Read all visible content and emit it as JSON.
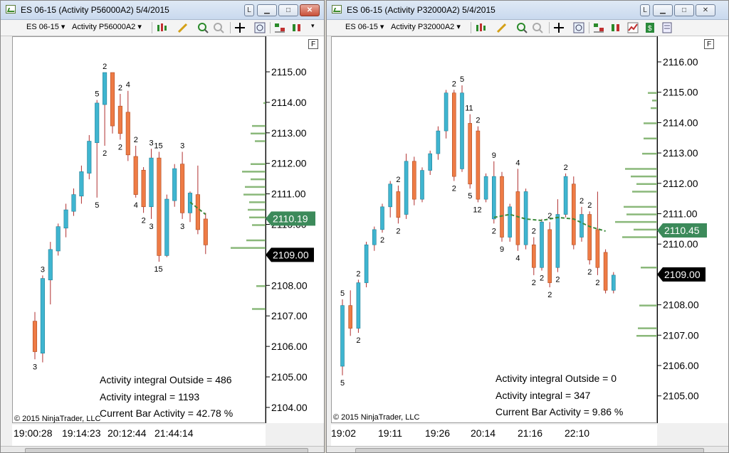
{
  "left": {
    "title": "ES 06-15 (Activity P56000A2)  5/4/2015",
    "instrument": "ES 06-15",
    "period": "Activity P56000A2",
    "f_label": "F",
    "price_min": 2104.0,
    "price_max": 2115.0,
    "y_ticks": [
      "2115.00",
      "2114.00",
      "2113.00",
      "2112.00",
      "2111.00",
      "2110.00",
      "2109.00",
      "2108.00",
      "2107.00",
      "2106.00",
      "2105.00",
      "2104.00"
    ],
    "x_labels": [
      "19:00:28",
      "19:14:23",
      "20:12:44",
      "21:44:14"
    ],
    "last_price": "2110.19",
    "current_price": "2109.00",
    "stat_outside": "Activity integral Outside  = 486",
    "stat_integral": "Activity integral = 1193",
    "stat_current": "Current Bar Activity = 42.78 %",
    "copyright": "© 2015 NinjaTrader, LLC",
    "candles": [
      {
        "o": 2106.85,
        "c": 2105.85,
        "h": 2107.15,
        "l": 2105.6,
        "up": false
      },
      {
        "o": 2105.8,
        "c": 2108.25,
        "h": 2108.35,
        "l": 2105.5,
        "up": true
      },
      {
        "o": 2108.2,
        "c": 2109.2,
        "h": 2109.45,
        "l": 2107.4,
        "up": true
      },
      {
        "o": 2109.15,
        "c": 2109.95,
        "h": 2110.05,
        "l": 2109.0,
        "up": true
      },
      {
        "o": 2109.9,
        "c": 2110.5,
        "h": 2110.7,
        "l": 2109.6,
        "up": true
      },
      {
        "o": 2110.45,
        "c": 2111.0,
        "h": 2111.2,
        "l": 2110.3,
        "up": true
      },
      {
        "o": 2110.95,
        "c": 2111.75,
        "h": 2111.95,
        "l": 2110.7,
        "up": true
      },
      {
        "o": 2111.7,
        "c": 2112.75,
        "h": 2112.95,
        "l": 2111.5,
        "up": true
      },
      {
        "o": 2112.7,
        "c": 2114.0,
        "h": 2114.1,
        "l": 2110.9,
        "up": true
      },
      {
        "o": 2113.95,
        "c": 2115.0,
        "h": 2115.0,
        "l": 2112.6,
        "up": true
      },
      {
        "o": 2115.0,
        "c": 2113.25,
        "h": 2115.0,
        "l": 2113.0,
        "up": false
      },
      {
        "o": 2113.9,
        "c": 2113.0,
        "h": 2114.3,
        "l": 2112.8,
        "up": false
      },
      {
        "o": 2113.7,
        "c": 2112.3,
        "h": 2114.4,
        "l": 2112.1,
        "up": false
      },
      {
        "o": 2112.25,
        "c": 2111.0,
        "h": 2112.6,
        "l": 2110.9,
        "up": false
      },
      {
        "o": 2111.8,
        "c": 2110.6,
        "h": 2111.9,
        "l": 2110.4,
        "up": false
      },
      {
        "o": 2110.6,
        "c": 2112.2,
        "h": 2112.5,
        "l": 2110.2,
        "up": true
      },
      {
        "o": 2112.2,
        "c": 2109.0,
        "h": 2112.4,
        "l": 2108.8,
        "up": false
      },
      {
        "o": 2109.0,
        "c": 2110.85,
        "h": 2111.0,
        "l": 2108.95,
        "up": true
      },
      {
        "o": 2110.8,
        "c": 2111.85,
        "h": 2112.0,
        "l": 2110.6,
        "up": true
      },
      {
        "o": 2112.0,
        "c": 2110.4,
        "h": 2112.4,
        "l": 2110.2,
        "up": false
      },
      {
        "o": 2110.4,
        "c": 2111.05,
        "h": 2111.1,
        "l": 2110.1,
        "up": true
      },
      {
        "o": 2111.0,
        "c": 2109.85,
        "h": 2111.95,
        "l": 2109.7,
        "up": false
      },
      {
        "o": 2110.2,
        "c": 2109.35,
        "h": 2110.4,
        "l": 2109.05,
        "up": false
      }
    ],
    "labels": [
      {
        "i": 0,
        "pos": "below",
        "t": "3"
      },
      {
        "i": 1,
        "pos": "above",
        "t": "3"
      },
      {
        "i": 8,
        "pos": "above",
        "t": "5"
      },
      {
        "i": 8,
        "pos": "below",
        "t": "5"
      },
      {
        "i": 9,
        "pos": "above",
        "t": "2"
      },
      {
        "i": 9,
        "pos": "below",
        "t": "2"
      },
      {
        "i": 11,
        "pos": "above",
        "t": "2"
      },
      {
        "i": 12,
        "pos": "above",
        "t": "4"
      },
      {
        "i": 11,
        "pos": "below",
        "t": "2"
      },
      {
        "i": 13,
        "pos": "above",
        "t": "2"
      },
      {
        "i": 13,
        "pos": "below",
        "t": "4"
      },
      {
        "i": 14,
        "pos": "below",
        "t": "2"
      },
      {
        "i": 15,
        "pos": "above",
        "t": "3"
      },
      {
        "i": 15,
        "pos": "below",
        "t": "3"
      },
      {
        "i": 16,
        "pos": "above",
        "t": "15"
      },
      {
        "i": 16,
        "pos": "below",
        "t": "15"
      },
      {
        "i": 19,
        "pos": "above",
        "t": "3"
      },
      {
        "i": 19,
        "pos": "below",
        "t": "3"
      }
    ],
    "ma": [
      [
        20,
        2110.75
      ],
      [
        21,
        2110.55
      ],
      [
        22,
        2110.35
      ]
    ],
    "volume_profile": [
      {
        "p": 2114.0,
        "w": 4
      },
      {
        "p": 2113.25,
        "w": 20
      },
      {
        "p": 2113.0,
        "w": 22
      },
      {
        "p": 2112.75,
        "w": 16
      },
      {
        "p": 2112.0,
        "w": 22
      },
      {
        "p": 2111.75,
        "w": 34
      },
      {
        "p": 2111.5,
        "w": 22
      },
      {
        "p": 2111.25,
        "w": 30
      },
      {
        "p": 2111.0,
        "w": 32
      },
      {
        "p": 2110.75,
        "w": 24
      },
      {
        "p": 2110.5,
        "w": 26
      },
      {
        "p": 2110.25,
        "w": 24
      },
      {
        "p": 2110.0,
        "w": 20
      },
      {
        "p": 2109.5,
        "w": 28
      },
      {
        "p": 2109.25,
        "w": 50
      },
      {
        "p": 2108.0,
        "w": 14
      },
      {
        "p": 2107.25,
        "w": 20
      }
    ]
  },
  "right": {
    "title": "ES 06-15 (Activity P32000A2)  5/4/2015",
    "instrument": "ES 06-15",
    "period": "Activity P32000A2",
    "f_label": "F",
    "price_min": 2105.0,
    "price_max": 2116.0,
    "y_ticks": [
      "2116.00",
      "2115.00",
      "2114.00",
      "2113.00",
      "2112.00",
      "2111.00",
      "2110.00",
      "2109.00",
      "2108.00",
      "2107.00",
      "2106.00",
      "2105.00"
    ],
    "x_labels": [
      "19:02",
      "19:11",
      "19:26",
      "20:14",
      "21:16",
      "22:10"
    ],
    "last_price": "2110.45",
    "current_price": "2109.00",
    "stat_outside": "Activity integral Outside  = 0",
    "stat_integral": "Activity integral = 347",
    "stat_current": "Current Bar Activity = 9.86 %",
    "copyright": "© 2015 NinjaTrader, LLC",
    "candles": [
      {
        "o": 2106.0,
        "c": 2108.0,
        "h": 2108.2,
        "l": 2105.7,
        "up": true
      },
      {
        "o": 2108.0,
        "c": 2107.25,
        "h": 2108.5,
        "l": 2107.0,
        "up": false
      },
      {
        "o": 2107.25,
        "c": 2108.75,
        "h": 2108.85,
        "l": 2107.1,
        "up": true
      },
      {
        "o": 2108.75,
        "c": 2110.0,
        "h": 2110.1,
        "l": 2108.6,
        "up": true
      },
      {
        "o": 2110.0,
        "c": 2110.5,
        "h": 2110.6,
        "l": 2109.8,
        "up": true
      },
      {
        "o": 2110.5,
        "c": 2111.25,
        "h": 2111.35,
        "l": 2110.4,
        "up": true
      },
      {
        "o": 2111.25,
        "c": 2112.0,
        "h": 2112.1,
        "l": 2110.9,
        "up": true
      },
      {
        "o": 2111.75,
        "c": 2110.9,
        "h": 2111.95,
        "l": 2110.7,
        "up": false
      },
      {
        "o": 2111.0,
        "c": 2112.75,
        "h": 2113.0,
        "l": 2110.85,
        "up": true
      },
      {
        "o": 2112.75,
        "c": 2111.5,
        "h": 2112.9,
        "l": 2111.3,
        "up": false
      },
      {
        "o": 2111.5,
        "c": 2112.45,
        "h": 2112.55,
        "l": 2111.4,
        "up": true
      },
      {
        "o": 2112.45,
        "c": 2113.0,
        "h": 2113.1,
        "l": 2112.3,
        "up": true
      },
      {
        "o": 2113.0,
        "c": 2113.75,
        "h": 2113.9,
        "l": 2112.8,
        "up": true
      },
      {
        "o": 2113.75,
        "c": 2115.0,
        "h": 2115.1,
        "l": 2113.5,
        "up": true
      },
      {
        "o": 2115.0,
        "c": 2112.25,
        "h": 2115.1,
        "l": 2112.1,
        "up": false
      },
      {
        "o": 2112.5,
        "c": 2115.0,
        "h": 2115.25,
        "l": 2112.4,
        "up": true
      },
      {
        "o": 2114.0,
        "c": 2112.0,
        "h": 2114.3,
        "l": 2111.85,
        "up": false
      },
      {
        "o": 2113.75,
        "c": 2111.5,
        "h": 2113.9,
        "l": 2111.4,
        "up": false
      },
      {
        "o": 2111.5,
        "c": 2112.25,
        "h": 2112.35,
        "l": 2111.4,
        "up": true
      },
      {
        "o": 2112.25,
        "c": 2110.85,
        "h": 2112.75,
        "l": 2110.7,
        "up": true
      },
      {
        "o": 2112.25,
        "c": 2110.25,
        "h": 2112.4,
        "l": 2110.1,
        "up": false
      },
      {
        "o": 2110.25,
        "c": 2111.25,
        "h": 2111.35,
        "l": 2110.1,
        "up": true
      },
      {
        "o": 2111.75,
        "c": 2110.0,
        "h": 2112.5,
        "l": 2109.8,
        "up": false
      },
      {
        "o": 2110.0,
        "c": 2111.75,
        "h": 2111.85,
        "l": 2109.85,
        "up": true
      },
      {
        "o": 2110.0,
        "c": 2109.25,
        "h": 2110.25,
        "l": 2109.0,
        "up": false
      },
      {
        "o": 2109.25,
        "c": 2110.75,
        "h": 2110.85,
        "l": 2109.15,
        "up": true
      },
      {
        "o": 2110.5,
        "c": 2108.75,
        "h": 2110.75,
        "l": 2108.6,
        "up": false
      },
      {
        "o": 2109.25,
        "c": 2111.0,
        "h": 2111.5,
        "l": 2109.1,
        "up": true
      },
      {
        "o": 2111.0,
        "c": 2112.25,
        "h": 2112.35,
        "l": 2110.9,
        "up": true
      },
      {
        "o": 2112.0,
        "c": 2110.0,
        "h": 2112.25,
        "l": 2109.85,
        "up": false
      },
      {
        "o": 2111.0,
        "c": 2110.25,
        "h": 2111.25,
        "l": 2110.1,
        "up": true
      },
      {
        "o": 2111.0,
        "c": 2109.5,
        "h": 2111.1,
        "l": 2109.35,
        "up": false
      },
      {
        "o": 2110.5,
        "c": 2109.25,
        "h": 2111.75,
        "l": 2109.0,
        "up": false
      },
      {
        "o": 2109.75,
        "c": 2108.5,
        "h": 2109.85,
        "l": 2108.4,
        "up": false
      },
      {
        "o": 2108.5,
        "c": 2109.0,
        "h": 2109.1,
        "l": 2108.4,
        "up": true
      }
    ],
    "labels": [
      {
        "i": 0,
        "pos": "above",
        "t": "5"
      },
      {
        "i": 0,
        "pos": "below",
        "t": "5"
      },
      {
        "i": 2,
        "pos": "above",
        "t": "2"
      },
      {
        "i": 2,
        "pos": "below",
        "t": "2"
      },
      {
        "i": 5,
        "pos": "below",
        "t": "2"
      },
      {
        "i": 7,
        "pos": "above",
        "t": "2"
      },
      {
        "i": 7,
        "pos": "below",
        "t": "2"
      },
      {
        "i": 14,
        "pos": "above",
        "t": "2"
      },
      {
        "i": 15,
        "pos": "above",
        "t": "5"
      },
      {
        "i": 14,
        "pos": "below",
        "t": "2"
      },
      {
        "i": 16,
        "pos": "above",
        "t": "11"
      },
      {
        "i": 16,
        "pos": "below",
        "t": "5"
      },
      {
        "i": 17,
        "pos": "above",
        "t": "2"
      },
      {
        "i": 17,
        "pos": "below",
        "t": "12"
      },
      {
        "i": 19,
        "pos": "above",
        "t": "9"
      },
      {
        "i": 19,
        "pos": "below",
        "t": "2"
      },
      {
        "i": 20,
        "pos": "below",
        "t": "9"
      },
      {
        "i": 22,
        "pos": "above",
        "t": "4"
      },
      {
        "i": 22,
        "pos": "below",
        "t": "4"
      },
      {
        "i": 24,
        "pos": "above",
        "t": "2"
      },
      {
        "i": 24,
        "pos": "below",
        "t": "2"
      },
      {
        "i": 25,
        "pos": "below",
        "t": "2"
      },
      {
        "i": 26,
        "pos": "above",
        "t": "2"
      },
      {
        "i": 26,
        "pos": "below",
        "t": "2"
      },
      {
        "i": 27,
        "pos": "below",
        "t": "2"
      },
      {
        "i": 28,
        "pos": "above",
        "t": "2"
      },
      {
        "i": 30,
        "pos": "above",
        "t": "2"
      },
      {
        "i": 31,
        "pos": "above",
        "t": "2"
      },
      {
        "i": 31,
        "pos": "below",
        "t": "2"
      },
      {
        "i": 32,
        "pos": "below",
        "t": "2"
      }
    ],
    "ma": [
      [
        19,
        2110.9
      ],
      [
        21,
        2111.0
      ],
      [
        23,
        2110.85
      ],
      [
        25,
        2110.8
      ],
      [
        27,
        2110.9
      ],
      [
        29,
        2110.85
      ],
      [
        31,
        2110.6
      ],
      [
        33,
        2110.45
      ]
    ],
    "volume_profile": [
      {
        "p": 2115.0,
        "w": 14
      },
      {
        "p": 2114.75,
        "w": 8
      },
      {
        "p": 2114.5,
        "w": 10
      },
      {
        "p": 2114.0,
        "w": 20
      },
      {
        "p": 2113.5,
        "w": 20
      },
      {
        "p": 2113.0,
        "w": 22
      },
      {
        "p": 2112.5,
        "w": 46
      },
      {
        "p": 2112.25,
        "w": 38
      },
      {
        "p": 2112.0,
        "w": 30
      },
      {
        "p": 2111.75,
        "w": 36
      },
      {
        "p": 2111.25,
        "w": 48
      },
      {
        "p": 2111.0,
        "w": 44
      },
      {
        "p": 2110.75,
        "w": 60
      },
      {
        "p": 2110.5,
        "w": 34
      },
      {
        "p": 2110.25,
        "w": 50
      },
      {
        "p": 2109.25,
        "w": 24
      },
      {
        "p": 2108.0,
        "w": 26
      },
      {
        "p": 2107.25,
        "w": 28
      },
      {
        "p": 2107.0,
        "w": 30
      }
    ]
  },
  "colors": {
    "up": "#3fb5d0",
    "down": "#ee7b45",
    "wick": "#b03030",
    "ma": "#3a8a3a",
    "vp": "#8ab87a",
    "last_bg": "#3c8a5a",
    "cur_bg": "#000000"
  },
  "icons": {
    "close": "close-icon",
    "minimize": "minimize-icon",
    "maximize": "maximize-icon",
    "restore": "restore-icon"
  }
}
